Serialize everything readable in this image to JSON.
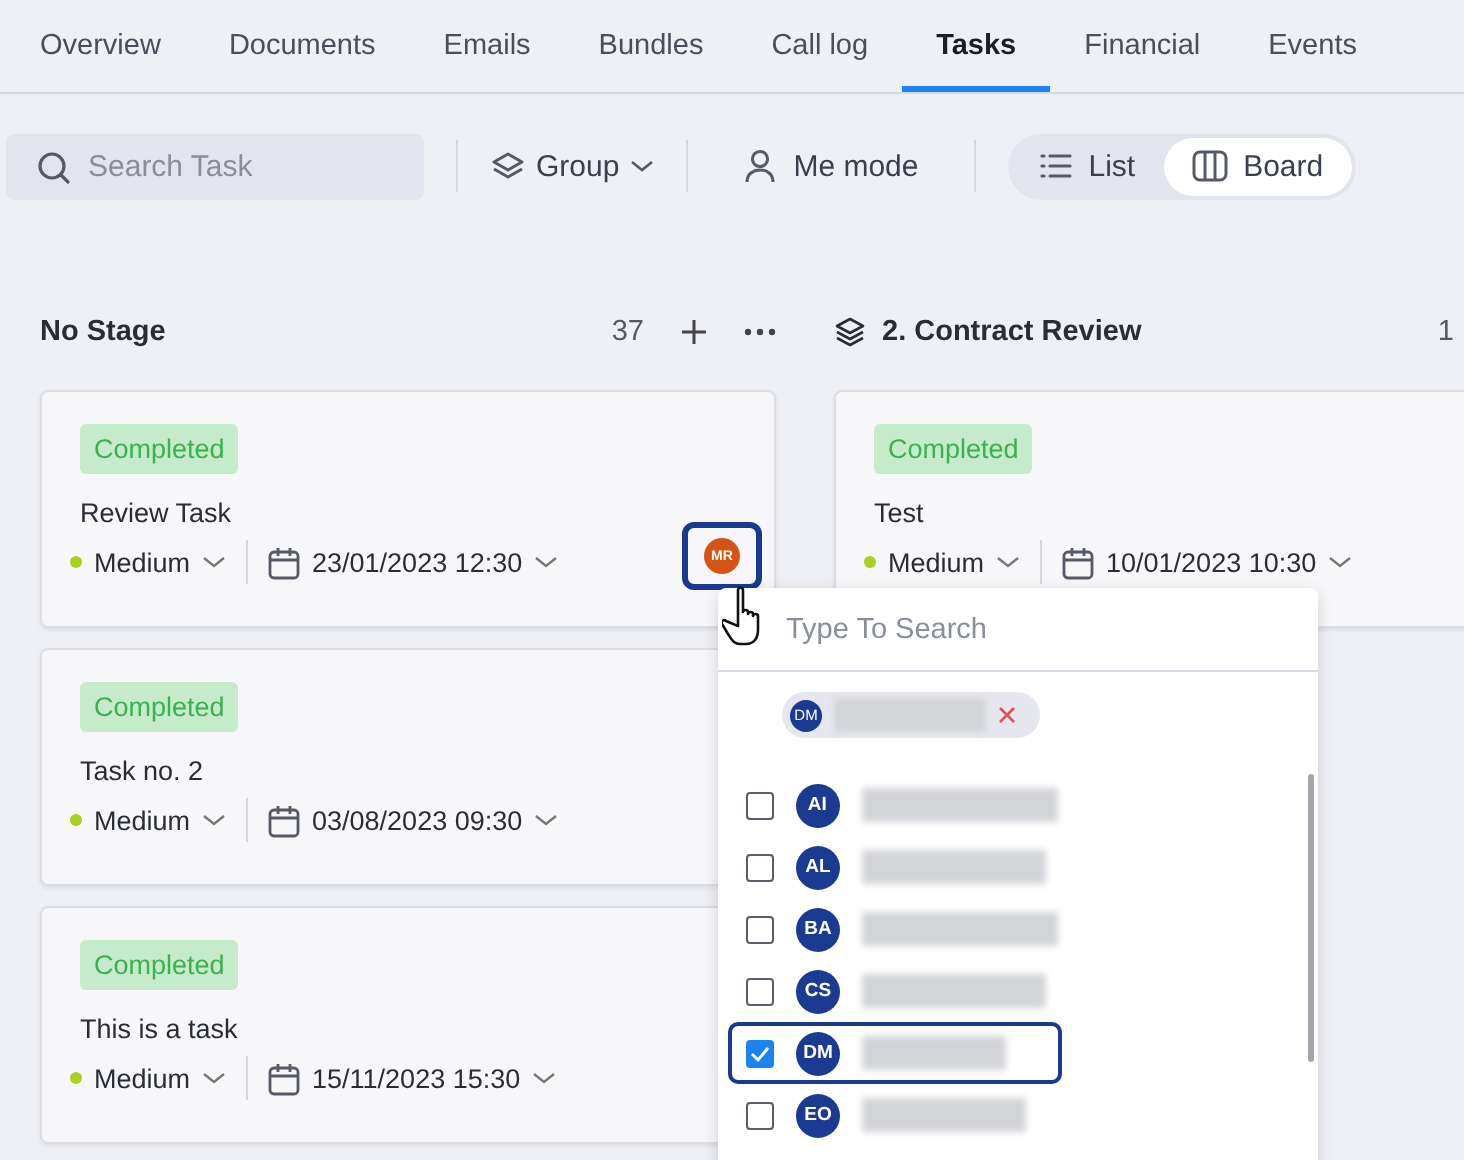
{
  "tabs": [
    {
      "label": "Overview",
      "selected": false
    },
    {
      "label": "Documents",
      "selected": false
    },
    {
      "label": "Emails",
      "selected": false
    },
    {
      "label": "Bundles",
      "selected": false
    },
    {
      "label": "Call log",
      "selected": false
    },
    {
      "label": "Tasks",
      "selected": true
    },
    {
      "label": "Financial",
      "selected": false
    },
    {
      "label": "Events",
      "selected": false
    }
  ],
  "toolbar": {
    "search": {
      "placeholder": "Search Task"
    },
    "group": "Group",
    "me_mode": "Me mode",
    "views": [
      {
        "label": "List",
        "kind": "list",
        "selected": false
      },
      {
        "label": "Board",
        "kind": "board",
        "selected": true
      }
    ]
  },
  "columns": [
    {
      "title": "No Stage",
      "count": "37",
      "kind": "unstaged",
      "cards": [
        {
          "status": "Completed",
          "title": "Review Task",
          "priority": "Medium",
          "date": "23/01/2023 12:30",
          "assignee": {
            "initials": "MR",
            "highlighted": true
          }
        },
        {
          "status": "Completed",
          "title": "Task no. 2",
          "priority": "Medium",
          "date": "03/08/2023 09:30"
        },
        {
          "status": "Completed",
          "title": "This is a task",
          "priority": "Medium",
          "date": "15/11/2023 15:30"
        }
      ]
    },
    {
      "title": "2. Contract Review",
      "count": "1",
      "kind": "stage",
      "cards": [
        {
          "status": "Completed",
          "title": "Test",
          "priority": "Medium",
          "date": "10/01/2023 10:30"
        }
      ]
    }
  ],
  "assignee_picker": {
    "placeholder": "Type To Search",
    "chips": [
      {
        "initials": "DM"
      }
    ],
    "options": [
      {
        "initials": "AI",
        "checked": false,
        "highlighted": false
      },
      {
        "initials": "AL",
        "checked": false,
        "highlighted": false
      },
      {
        "initials": "BA",
        "checked": false,
        "highlighted": false
      },
      {
        "initials": "CS",
        "checked": false,
        "highlighted": false
      },
      {
        "initials": "DM",
        "checked": true,
        "highlighted": true
      },
      {
        "initials": "EO",
        "checked": false,
        "highlighted": false
      }
    ]
  }
}
